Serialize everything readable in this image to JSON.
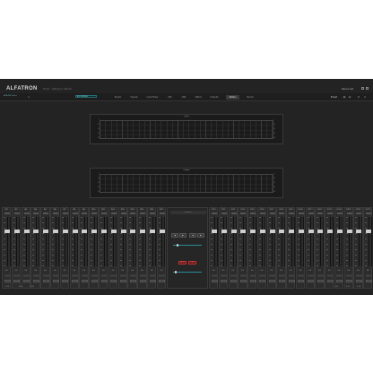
{
  "app": {
    "logo": "ALFATRON",
    "menu": [
      "File (F)",
      "Setting (S)",
      "Help (H)"
    ],
    "device_name": "Device List",
    "status": [
      "ALFA-DSP",
      "Online"
    ],
    "selected_device": "ALF-DSP88-A",
    "preset_label": "Preset"
  },
  "tabs": [
    {
      "label": "Router",
      "active": false
    },
    {
      "label": "Signals",
      "active": false
    },
    {
      "label": "Input Mixer",
      "active": false
    },
    {
      "label": "AEC",
      "active": false
    },
    {
      "label": "ANS",
      "active": false
    },
    {
      "label": "Matrix",
      "active": false
    },
    {
      "label": "Outputs",
      "active": false
    },
    {
      "label": "Meters",
      "active": true
    },
    {
      "label": "Ducker",
      "active": false
    }
  ],
  "rta": [
    {
      "title": "Input"
    },
    {
      "title": "Output"
    }
  ],
  "rta_scale_left": [
    "0",
    "-10",
    "-20",
    "-30",
    "-40"
  ],
  "rta_scale_right": [
    "0",
    "-10",
    "-20",
    "-30",
    "-40"
  ],
  "input_strips": [
    {
      "label": "IN1",
      "value": "0.0"
    },
    {
      "label": "IN2",
      "value": "0.0"
    },
    {
      "label": "IN3",
      "value": "0.0"
    },
    {
      "label": "IN4",
      "value": "0.0"
    },
    {
      "label": "IN5",
      "value": "0.0"
    },
    {
      "label": "IN6",
      "value": "0.0"
    },
    {
      "label": "IN7",
      "value": "0.0"
    },
    {
      "label": "IN8",
      "value": "0.0"
    },
    {
      "label": "IN9",
      "value": "0.0"
    },
    {
      "label": "IN10",
      "value": "0.0"
    },
    {
      "label": "IN11",
      "value": "0.0"
    },
    {
      "label": "IN12",
      "value": "0.0"
    },
    {
      "label": "IN13",
      "value": "0.0"
    },
    {
      "label": "IN14",
      "value": "0.0"
    },
    {
      "label": "IN15",
      "value": "0.0"
    },
    {
      "label": "IN16",
      "value": "0.0"
    },
    {
      "label": "IN17",
      "value": "0.0"
    }
  ],
  "output_strips": [
    {
      "label": "OUT1",
      "value": "0.0"
    },
    {
      "label": "OUT2",
      "value": "0.0"
    },
    {
      "label": "OUT3",
      "value": "0.0"
    },
    {
      "label": "OUT4",
      "value": "0.0"
    },
    {
      "label": "OUT5",
      "value": "0.0"
    },
    {
      "label": "OUT6",
      "value": "0.0"
    },
    {
      "label": "OUT7",
      "value": "0.0"
    },
    {
      "label": "OUT8",
      "value": "0.0"
    },
    {
      "label": "OUT9",
      "value": "0.0"
    },
    {
      "label": "OUT10",
      "value": "0.0"
    },
    {
      "label": "OUT11",
      "value": "0.0"
    },
    {
      "label": "OUT12",
      "value": "0.0"
    },
    {
      "label": "OUT13",
      "value": "0.0"
    },
    {
      "label": "OUT14",
      "value": "0.0"
    },
    {
      "label": "OUT15",
      "value": "0.0"
    },
    {
      "label": "OUT16",
      "value": "0.0"
    },
    {
      "label": "OUT17",
      "value": "0.0"
    }
  ],
  "center": {
    "header": "Channel",
    "buttons": [
      "◀",
      "▶",
      "◀",
      "▶"
    ],
    "red_buttons": [
      "MUTE",
      "OFF"
    ]
  },
  "footer": {
    "left": [
      "0.00",
      "0.00",
      "0.00"
    ],
    "right": [
      "0.00",
      "0.00",
      "0.00"
    ]
  },
  "colors": {
    "accent": "#2a8c9a",
    "background": "#232323"
  }
}
